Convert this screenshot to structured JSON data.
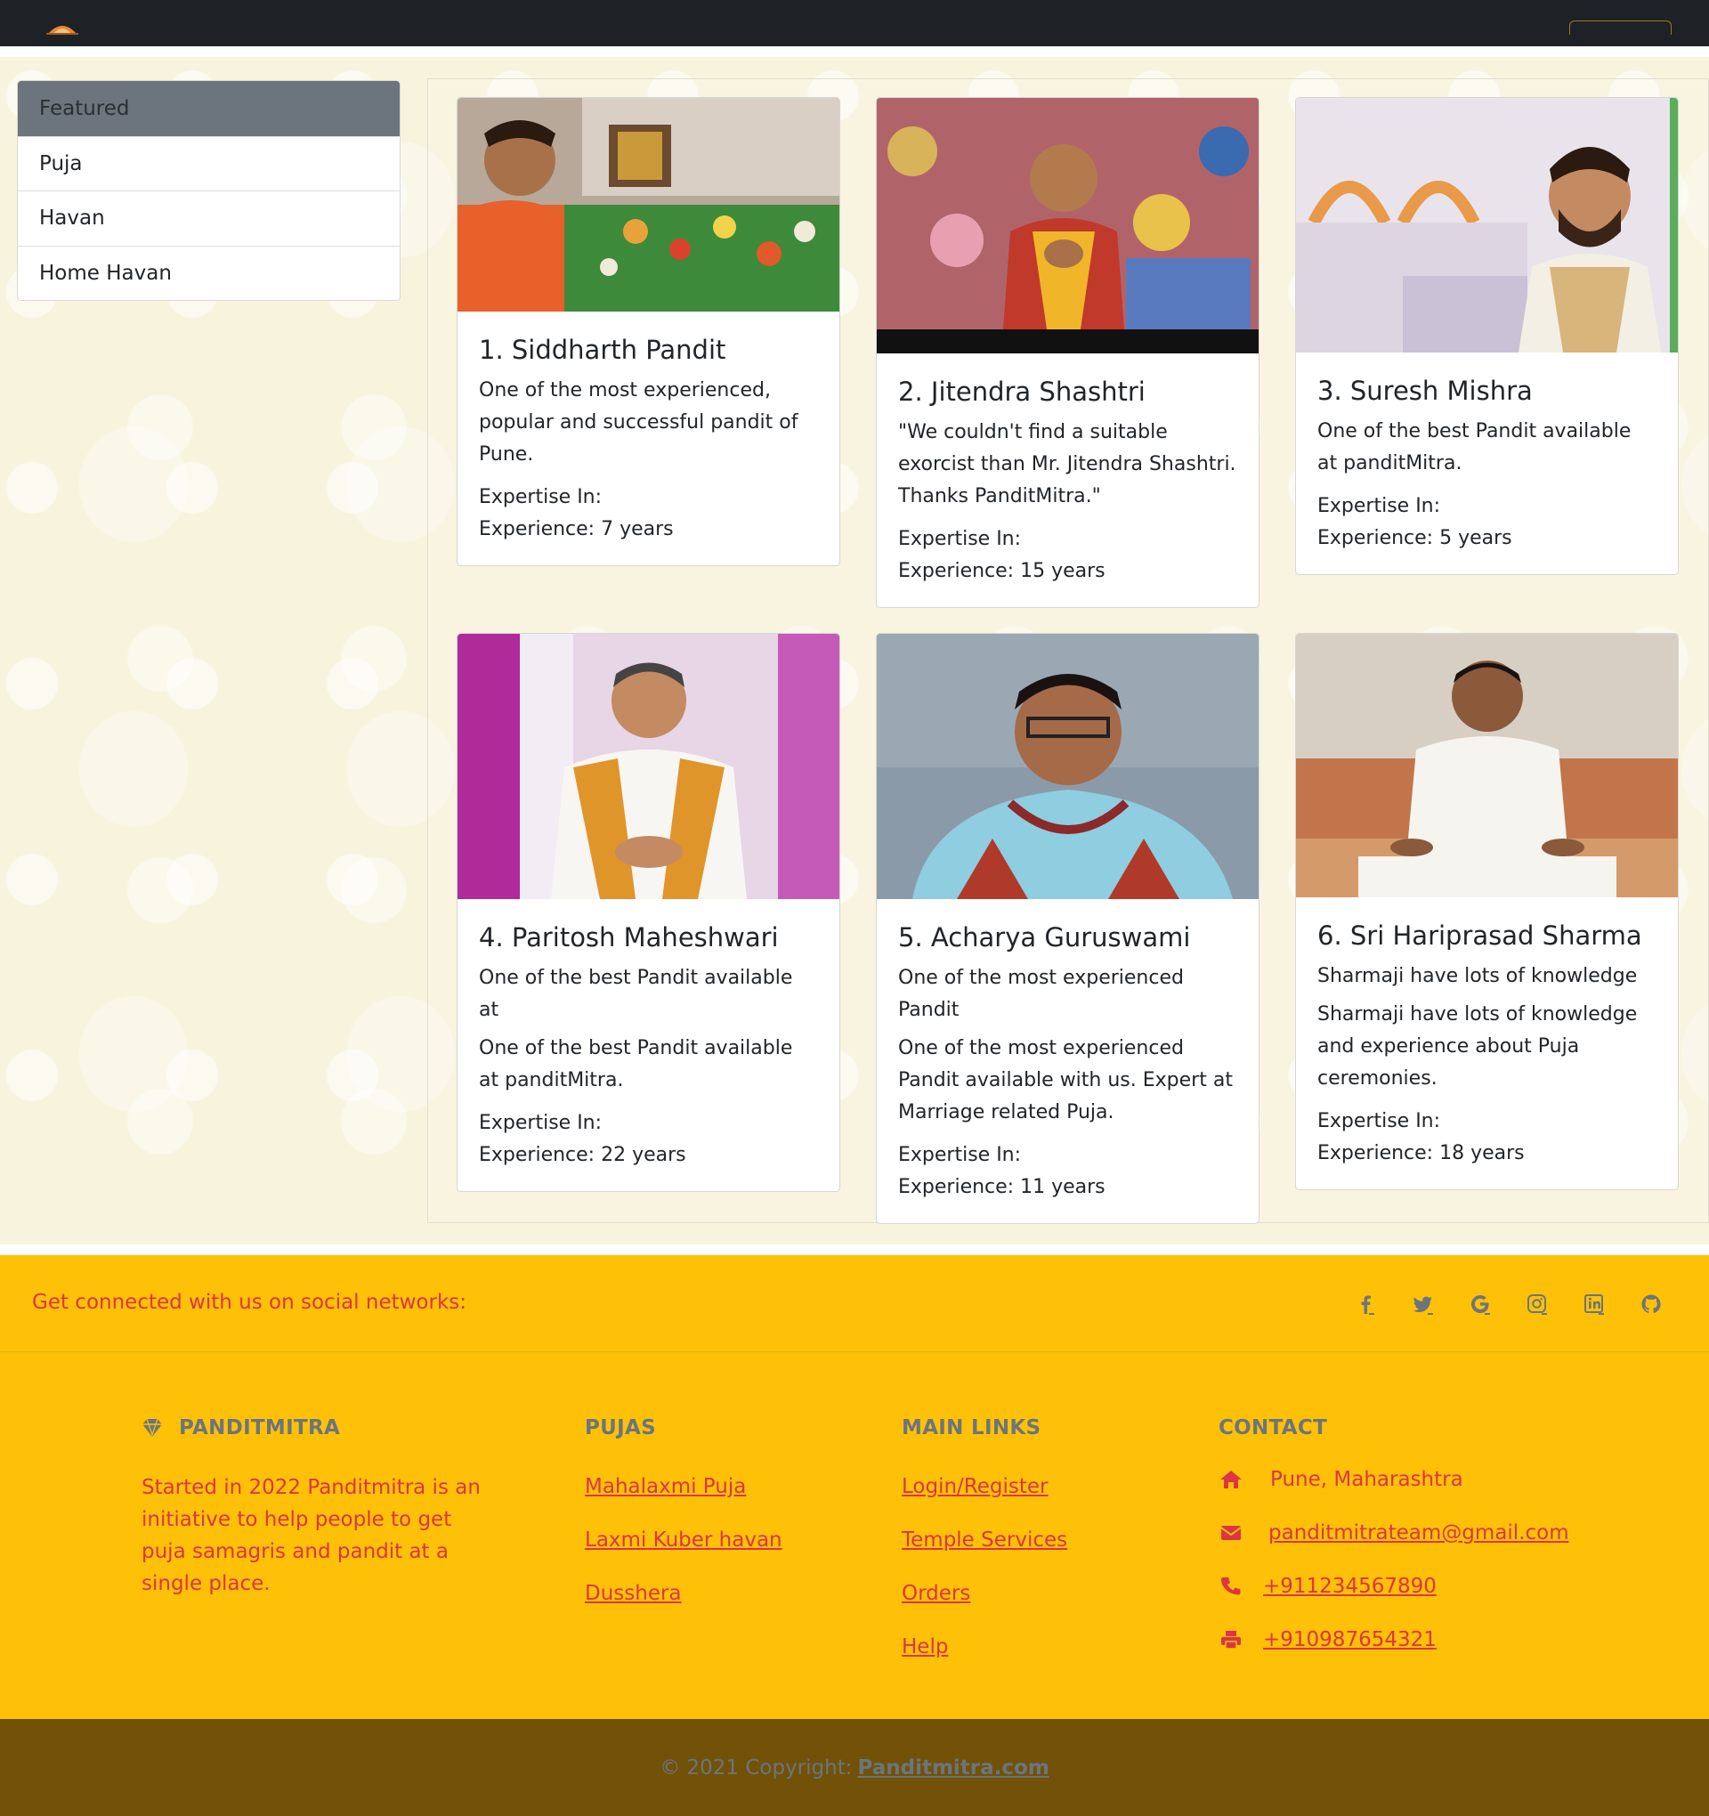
{
  "sidebar": {
    "items": [
      {
        "label": "Featured"
      },
      {
        "label": "Puja"
      },
      {
        "label": "Havan"
      },
      {
        "label": "Home Havan"
      }
    ]
  },
  "cards": [
    {
      "title": "1. Siddharth Pandit",
      "subtitle": "",
      "text": "One of the most experienced, popular and successful pandit of Pune.",
      "expertise": "Expertise In:",
      "experience": "Experience: 7 years"
    },
    {
      "title": "2. Jitendra Shashtri",
      "subtitle": "",
      "text": "\"We couldn't find a suitable exorcist than Mr. Jitendra Shashtri. Thanks PanditMitra.\"",
      "expertise": "Expertise In:",
      "experience": "Experience: 15 years"
    },
    {
      "title": "3. Suresh Mishra",
      "subtitle": "",
      "text": "One of the best Pandit available at panditMitra.",
      "expertise": "Expertise In:",
      "experience": "Experience: 5 years"
    },
    {
      "title": "4. Paritosh Maheshwari",
      "subtitle": "One of the best Pandit available at",
      "text": "One of the best Pandit available at panditMitra.",
      "expertise": "Expertise In:",
      "experience": "Experience: 22 years"
    },
    {
      "title": "5. Acharya Guruswami",
      "subtitle": "One of the most experienced Pandit",
      "text": "One of the most experienced Pandit available with us. Expert at Marriage related Puja.",
      "expertise": "Expertise In:",
      "experience": "Experience: 11 years"
    },
    {
      "title": "6. Sri Hariprasad Sharma",
      "subtitle": "Sharmaji have lots of knowledge",
      "text": "Sharmaji have lots of knowledge and experience about Puja ceremonies.",
      "expertise": "Expertise In:",
      "experience": "Experience: 18 years"
    }
  ],
  "social": {
    "text": "Get connected with us on social networks:",
    "icons": [
      "facebook-icon",
      "twitter-icon",
      "google-icon",
      "instagram-icon",
      "linkedin-icon",
      "github-icon"
    ]
  },
  "footer": {
    "brand": "PANDITMITRA",
    "about": "Started in 2022 Panditmitra is an initiative to help people to get puja samagris and pandit at a single place.",
    "pujas_heading": "PUJAS",
    "pujas": [
      "Mahalaxmi Puja",
      "Laxmi Kuber havan",
      "Dusshera"
    ],
    "links_heading": "MAIN LINKS",
    "links": [
      "Login/Register",
      "Temple Services",
      "Orders",
      "Help"
    ],
    "contact_heading": "CONTACT",
    "address": "Pune, Maharashtra",
    "email": "panditmitrateam@gmail.com",
    "phone": "+911234567890",
    "fax": "+910987654321"
  },
  "copyright": {
    "text": "© 2021 Copyright:",
    "link": "Panditmitra.com"
  },
  "colors": {
    "navbar": "#1e2125",
    "accent": "#ffc107",
    "link_red": "#dc3545",
    "muted": "#6c757d",
    "copyright_bg": "#715208"
  }
}
